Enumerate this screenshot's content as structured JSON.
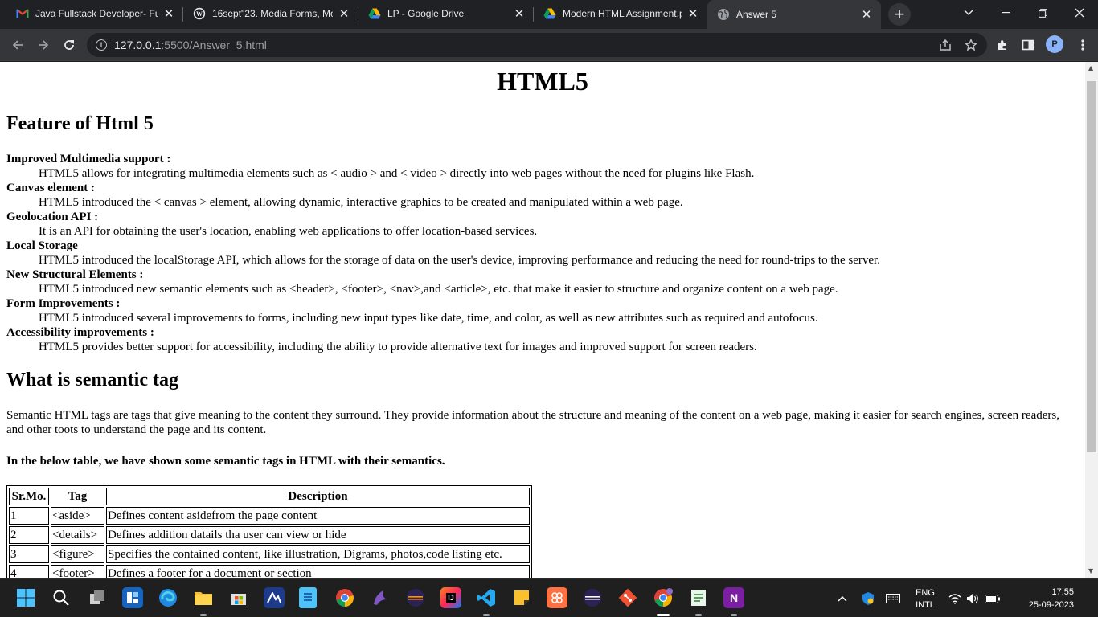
{
  "browser": {
    "tabs": [
      {
        "title": "Java Fullstack Developer- Fu",
        "icon": "gmail-icon",
        "active": false
      },
      {
        "title": "16sept\"23. Media Forms, Mo",
        "icon": "wordpress-icon",
        "active": false
      },
      {
        "title": "LP - Google Drive",
        "icon": "google-drive-icon",
        "active": false
      },
      {
        "title": "Modern HTML Assignment.p",
        "icon": "google-drive-icon",
        "active": false
      },
      {
        "title": "Answer 5",
        "icon": "globe-icon",
        "active": true
      }
    ],
    "new_tab": "+",
    "url_host": "127.0.0.1",
    "url_path": ":5500/Answer_5.html",
    "profile_initial": "P",
    "accent": "#8ab4f8"
  },
  "page": {
    "title": "HTML5",
    "features_heading": "Feature of Html 5",
    "features": [
      {
        "term": "Improved Multimedia support :",
        "desc": "HTML5 allows for integrating multimedia elements such as < audio > and < video > directly into web pages without the need for plugins like Flash."
      },
      {
        "term": "Canvas element :",
        "desc": "HTML5 introduced the < canvas > element, allowing dynamic, interactive graphics to be created and manipulated within a web page."
      },
      {
        "term": "Geolocation API :",
        "desc": "It is an API for obtaining the user's location, enabling web applications to offer location-based services."
      },
      {
        "term": "Local Storage",
        "desc": "HTML5 introduced the localStorage API, which allows for the storage of data on the user's device, improving performance and reducing the need for round-trips to the server."
      },
      {
        "term": "New Structural Elements :",
        "desc": "HTML5 introduced new semantic elements such as <header>, <footer>, <nav>,and <article>, etc. that make it easier to structure and organize content on a web page."
      },
      {
        "term": "Form Improvements :",
        "desc": "HTML5 introduced several improvements to forms, including new input types like date, time, and color, as well as new attributes such as required and autofocus."
      },
      {
        "term": "Accessibility improvements :",
        "desc": "HTML5 provides better support for accessibility, including the ability to provide alternative text for images and improved support for screen readers."
      }
    ],
    "semantic_heading": "What is semantic tag",
    "semantic_para": "Semantic HTML tags are tags that give meaning to the content they surround. They provide information about the structure and meaning of the content on a web page, making it easier for search engines, screen readers, and other toots to understand the page and its content.",
    "table_intro": "In the below table, we have shown some semantic tags in HTML with their semantics.",
    "table": {
      "headers": [
        "Sr.Mo.",
        "Tag",
        "Description"
      ],
      "rows": [
        [
          "1",
          "<aside>",
          "Defines content asidefrom the page content"
        ],
        [
          "2",
          "<details>",
          "Defines addition datails tha user can view or hide"
        ],
        [
          "3",
          "<figure>",
          "Specifies the contained content, like illustration, Digrams, photos,code listing etc."
        ],
        [
          "4",
          "<footer>",
          "Defines a footer for a document or section"
        ]
      ]
    }
  },
  "taskbar": {
    "apps": [
      "start",
      "search",
      "task-view",
      "widgets",
      "edge",
      "file-explorer",
      "store",
      "vscode-insiders",
      "notepad",
      "chrome",
      "dolphin",
      "eclipse",
      "intellij",
      "vscode",
      "sticky-notes",
      "app-launcher",
      "eclipse-2",
      "git",
      "chrome-profile",
      "notepad-plus",
      "onenote"
    ],
    "lang_top": "ENG",
    "lang_bottom": "INTL",
    "time": "17:55",
    "date": "25-09-2023"
  }
}
